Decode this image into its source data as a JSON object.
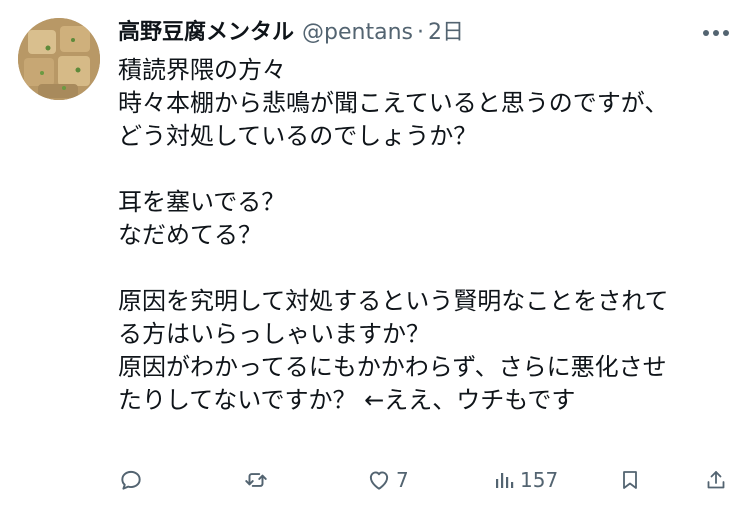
{
  "user": {
    "display_name": "高野豆腐メンタル",
    "handle": "@pentans",
    "separator": "·",
    "time": "2日",
    "avatar_icon": "tofu-avatar-image"
  },
  "tweet": {
    "lines": [
      "積読界隈の方々",
      "時々本棚から悲鳴が聞こえていると思うのですが、",
      "どう対処しているのでしょうか？",
      "",
      "耳を塞いでる？",
      "なだめてる？",
      "",
      "原因を究明して対処するという賢明なことをされて",
      "る方はいらっしゃいますか？",
      "原因がわかってるにもかかわらず、さらに悪化させ",
      "たりしてないですか？ ←ええ、ウチもです"
    ]
  },
  "actions": {
    "reply": {
      "icon": "reply-icon",
      "count": ""
    },
    "retweet": {
      "icon": "retweet-icon",
      "count": ""
    },
    "like": {
      "icon": "heart-icon",
      "count": "7"
    },
    "views": {
      "icon": "views-chart-icon",
      "count": "157"
    },
    "bookmark": {
      "icon": "bookmark-icon"
    },
    "share": {
      "icon": "share-icon"
    }
  },
  "colors": {
    "text": "#0f1419",
    "muted": "#536471",
    "background": "#ffffff"
  }
}
